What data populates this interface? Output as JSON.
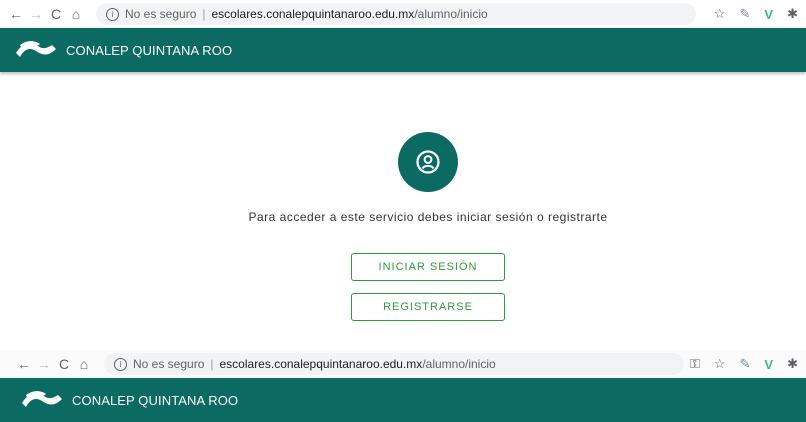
{
  "browser_top": {
    "security_label": "No es seguro",
    "url_host": "escolares.conalepquintanaroo.edu.mx",
    "url_path": "/alumno/inicio"
  },
  "browser_bottom": {
    "security_label": "No es seguro",
    "url_host": "escolares.conalepquintanaroo.edu.mx",
    "url_path": "/alumno/inicio"
  },
  "header": {
    "brand": "CONALEP QUINTANA ROO"
  },
  "main": {
    "message": "Para acceder a este servicio debes iniciar sesión o registrarte",
    "login_label": "INICIAR SESIÓN",
    "register_label": "REGISTRARSE"
  },
  "colors": {
    "primary": "#0b6b62",
    "button_accent": "#2e9a3e"
  }
}
